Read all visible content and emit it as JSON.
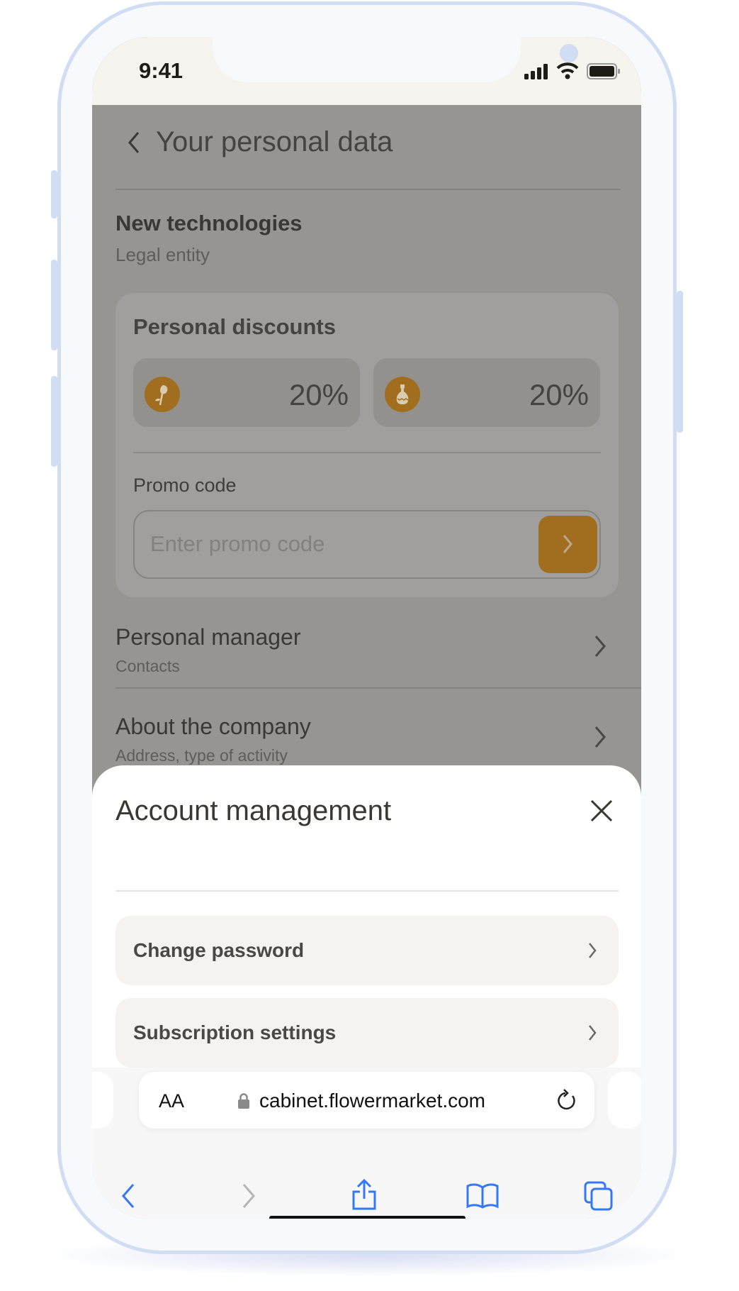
{
  "status_bar": {
    "time": "9:41"
  },
  "header": {
    "title": "Your personal data"
  },
  "company": {
    "name": "New technologies",
    "type": "Legal entity"
  },
  "discounts": {
    "title": "Personal discounts",
    "items": [
      {
        "icon": "flower-icon",
        "value": "20%"
      },
      {
        "icon": "vase-icon",
        "value": "20%"
      }
    ]
  },
  "promo": {
    "label": "Promo code",
    "placeholder": "Enter promo code"
  },
  "rows": [
    {
      "title": "Personal manager",
      "subtitle": "Contacts"
    },
    {
      "title": "About the company",
      "subtitle": "Address, type of activity"
    }
  ],
  "sheet": {
    "title": "Account management",
    "options": [
      {
        "label": "Change password"
      },
      {
        "label": "Subscription settings"
      }
    ]
  },
  "browser": {
    "text_size": "AA",
    "url": "cabinet.flowermarket.com"
  },
  "colors": {
    "accent": "#a06e1e",
    "overlay": "#979591",
    "browser_blue": "#3478f6"
  }
}
